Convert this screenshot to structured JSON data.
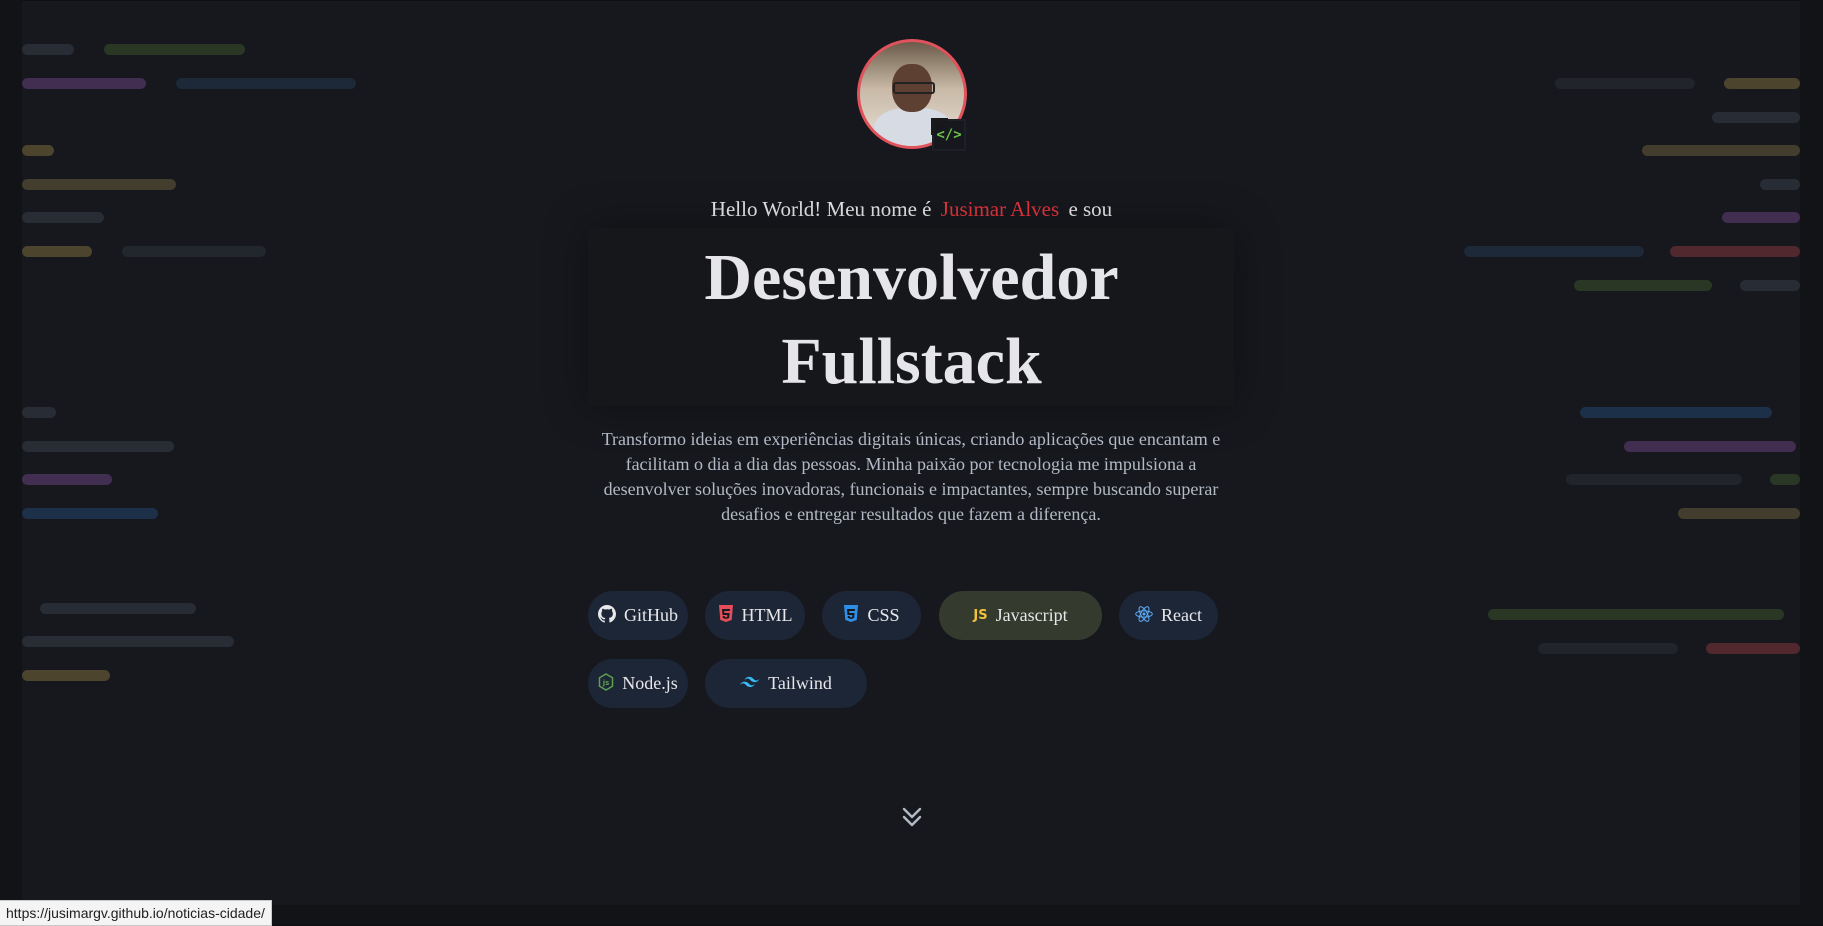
{
  "profile": {
    "avatar_alt": "Profile photo",
    "badge_icon": "</>"
  },
  "hero": {
    "greeting_prefix": "Hello World! Meu nome é",
    "name": "Jusimar Alves",
    "greeting_suffix": "e sou",
    "title_line1": "Desenvolvedor",
    "title_line2": "Fullstack",
    "description": "Transformo ideias em experiências digitais únicas, criando aplicações que encantam e facilitam o dia a dia das pessoas. Minha paixão por tecnologia me impulsiona a desenvolver soluções inovadoras, funcionais e impactantes, sempre buscando superar desafios e entregar resultados que fazem a diferença."
  },
  "badges": [
    {
      "label": "GitHub",
      "icon": "github-icon",
      "color": "#e8e8ea"
    },
    {
      "label": "HTML",
      "icon": "html5-icon",
      "color": "#e44d5a"
    },
    {
      "label": "CSS",
      "icon": "css3-icon",
      "color": "#2f8fe6"
    },
    {
      "label": "Javascript",
      "icon": "js-icon",
      "color": "#f0c23b"
    },
    {
      "label": "React",
      "icon": "react-icon",
      "color": "#5aa6f0"
    },
    {
      "label": "Node.js",
      "icon": "nodejs-icon",
      "color": "#5fa04e"
    },
    {
      "label": "Tailwind",
      "icon": "tailwind-icon",
      "color": "#38bdf8"
    }
  ],
  "scroll_indicator": {
    "icon": "double-chevron-down-icon"
  },
  "status_url": "https://jusimargv.github.io/noticias-cidade/",
  "colors": {
    "accent": "#e5343e",
    "background": "#16181d",
    "badge_bg": "#1d2637"
  }
}
